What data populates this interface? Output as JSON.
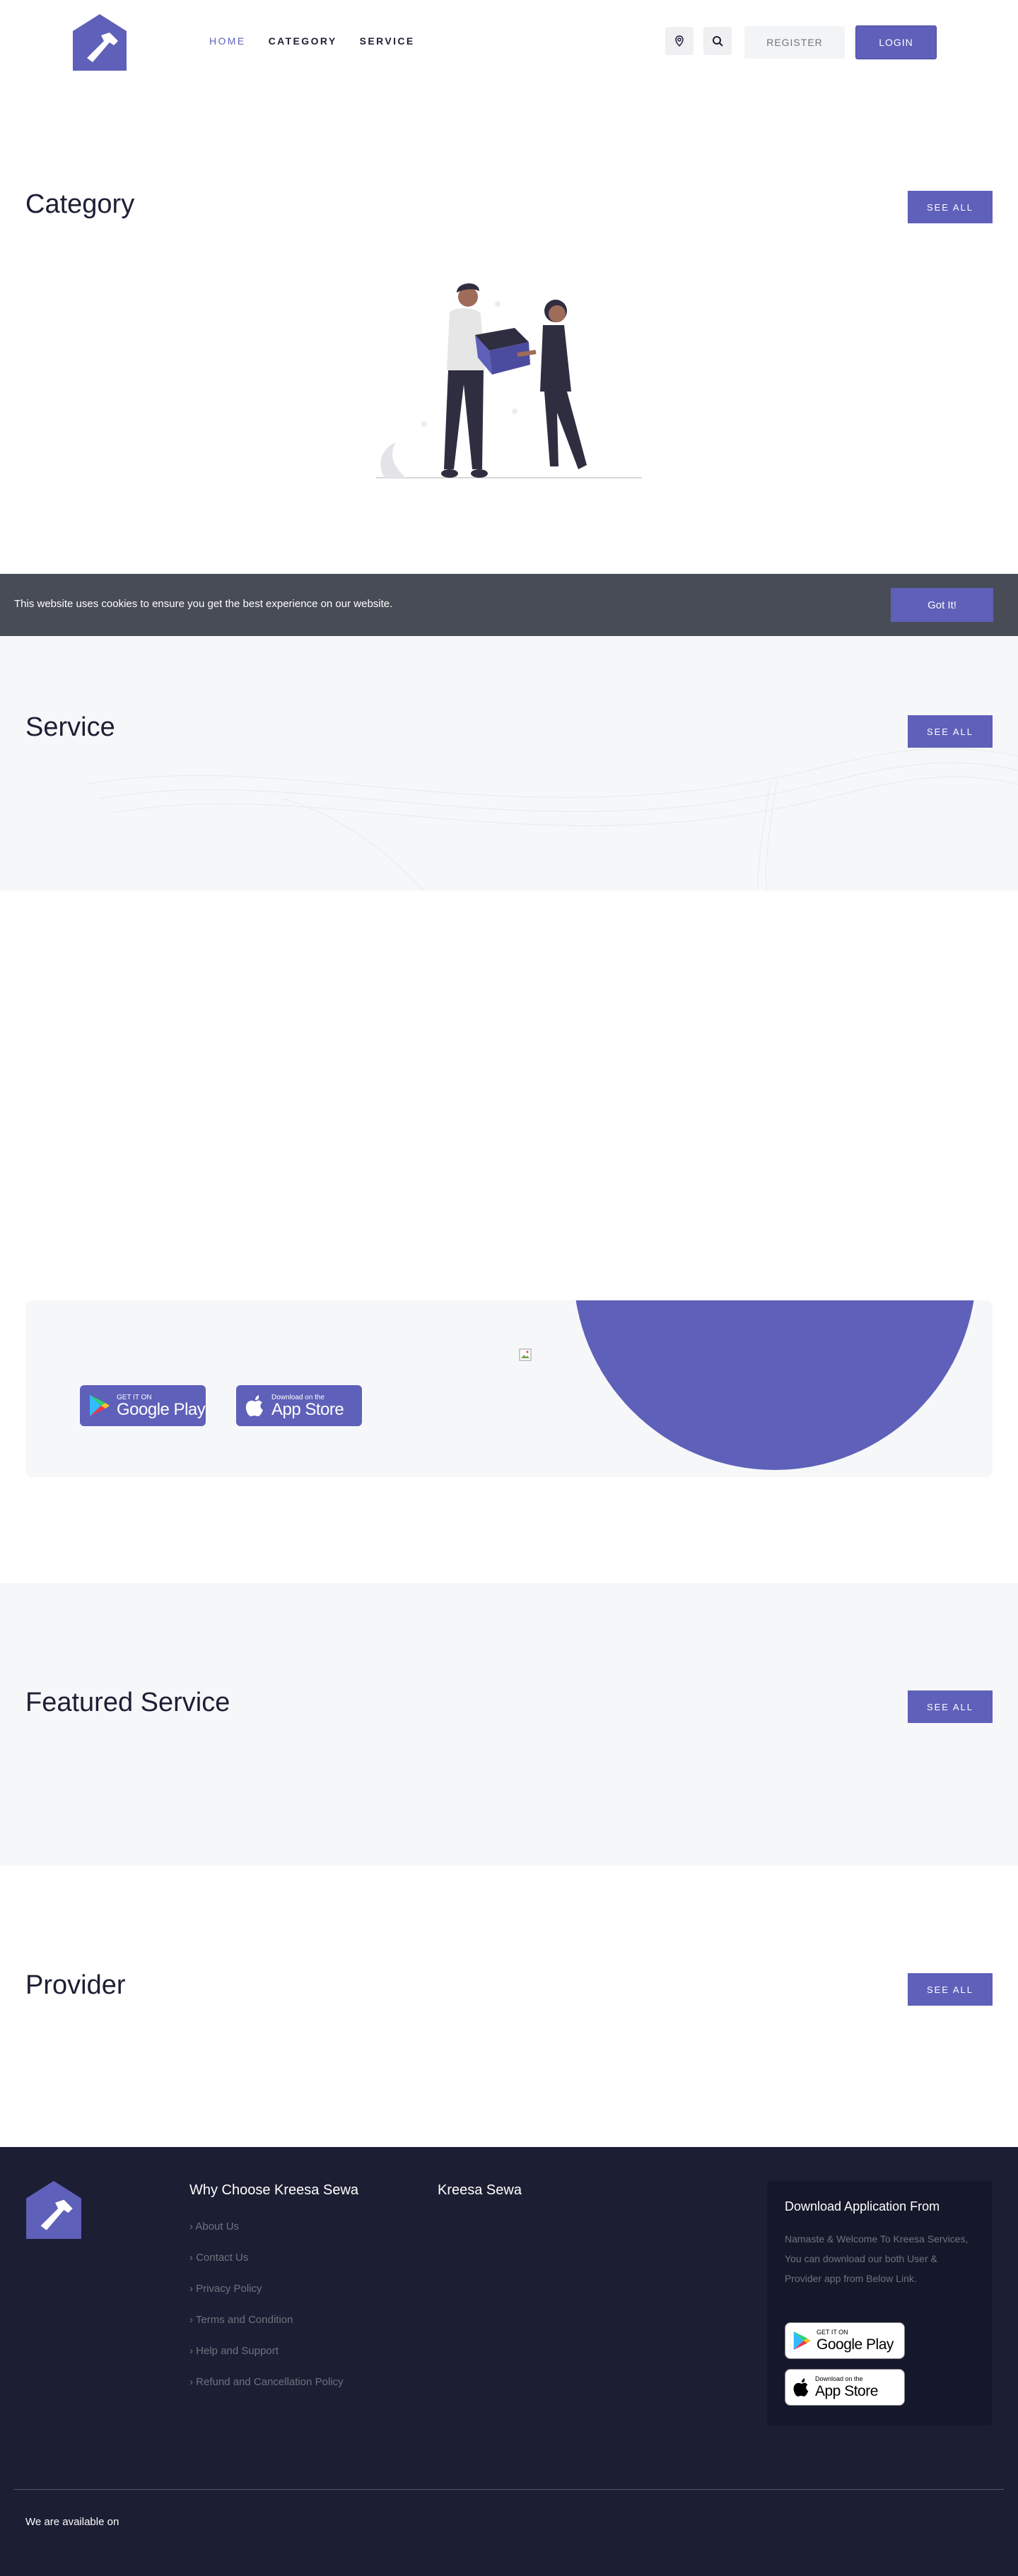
{
  "header": {
    "nav": [
      {
        "label": "HOME",
        "active": true
      },
      {
        "label": "CATEGORY",
        "active": false
      },
      {
        "label": "SERVICE",
        "active": false
      }
    ],
    "icons": [
      "map-pin-icon",
      "search-icon"
    ],
    "register_label": "REGISTER",
    "login_label": "LOGIN"
  },
  "sections": {
    "category": {
      "title": "Category",
      "see_all": "SEE ALL"
    },
    "service": {
      "title": "Service",
      "see_all": "SEE ALL"
    },
    "featured": {
      "title": "Featured Service",
      "see_all": "SEE ALL"
    },
    "provider": {
      "title": "Provider",
      "see_all": "SEE ALL"
    }
  },
  "cookie": {
    "text": "This website uses cookies to ensure you get the best experience on our website.",
    "button": "Got It!"
  },
  "app_banner": {
    "google_small": "GET IT ON",
    "google_big": "Google Play",
    "apple_small": "Download on the",
    "apple_big": "App Store"
  },
  "footer": {
    "why_title": "Why Choose Kreesa Sewa",
    "brand_title": "Kreesa Sewa",
    "links": [
      "About Us",
      "Contact Us",
      "Privacy Policy",
      "Terms and Condition",
      "Help and Support",
      "Refund and Cancellation Policy"
    ],
    "download_title": "Download Application From",
    "download_text": "Namaste & Welcome To Kreesa Services, You can download our both User & Provider app from Below Link.",
    "google_small": "GET IT ON",
    "google_big": "Google Play",
    "apple_small": "Download on the",
    "apple_big": "App Store",
    "available_text": "We are available on"
  },
  "colors": {
    "accent": "#5f60b9",
    "footer_bg": "#1c1e33",
    "cookie_bg": "#484c56",
    "section_bg": "#f6f7f9"
  }
}
